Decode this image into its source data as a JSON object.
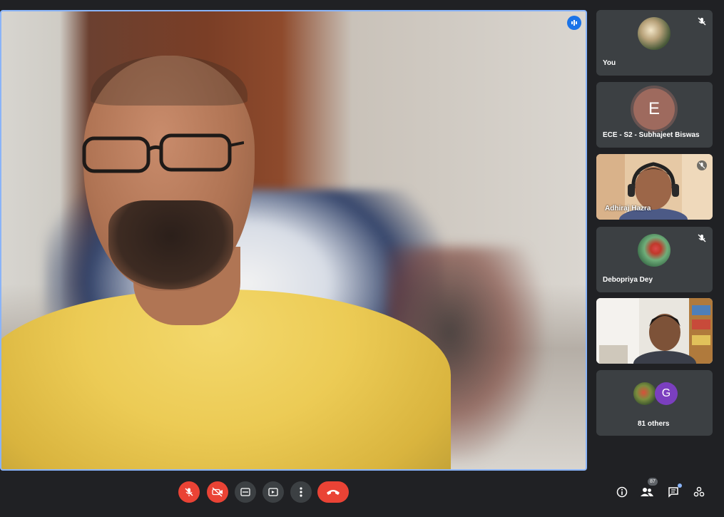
{
  "participants": [
    {
      "name": "You",
      "muted": true
    },
    {
      "name": "ECE - S2 - Subhajeet Biswas",
      "initial": "E",
      "muted": false
    },
    {
      "name": "Adhiraj Hazra",
      "muted": true
    },
    {
      "name": "Debopriya Dey",
      "muted": true
    },
    {
      "name": "",
      "muted": false
    }
  ],
  "others": {
    "label": "81 others",
    "initial": "G"
  },
  "people_count": "87",
  "colors": {
    "background": "#202124",
    "tile": "#3c4043",
    "accent_blue": "#8ab4f8",
    "danger_red": "#ea4335"
  },
  "controls": [
    {
      "name": "mic-off",
      "state": "off"
    },
    {
      "name": "camera-off",
      "state": "off"
    },
    {
      "name": "captions",
      "state": "off"
    },
    {
      "name": "present",
      "state": "off"
    },
    {
      "name": "more-options",
      "state": "none"
    },
    {
      "name": "leave-call",
      "state": "none"
    }
  ],
  "side_icons": [
    "info-icon",
    "people-icon",
    "chat-icon",
    "activities-icon"
  ]
}
